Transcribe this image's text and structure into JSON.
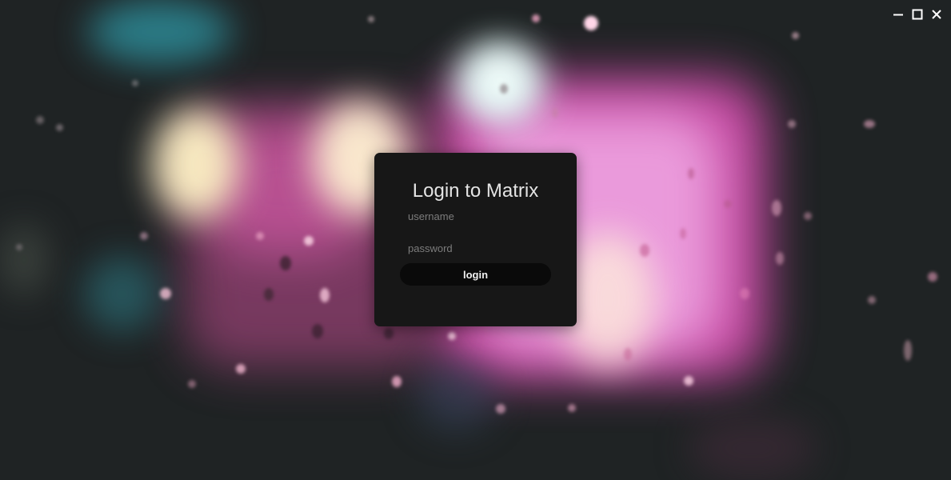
{
  "window": {
    "controls": [
      {
        "icon": "minimize-icon"
      },
      {
        "icon": "maximize-icon"
      },
      {
        "icon": "close-icon"
      }
    ]
  },
  "login": {
    "title": "Login to Matrix",
    "username_placeholder": "username",
    "username_value": "",
    "password_placeholder": "password",
    "password_value": "",
    "button_label": "login"
  },
  "colors": {
    "card_background": "#171717",
    "button_background": "#0a0a0a",
    "title_text": "#e4e4e4",
    "placeholder_text": "#7c7c7c",
    "window_controls": "#ffffff"
  }
}
